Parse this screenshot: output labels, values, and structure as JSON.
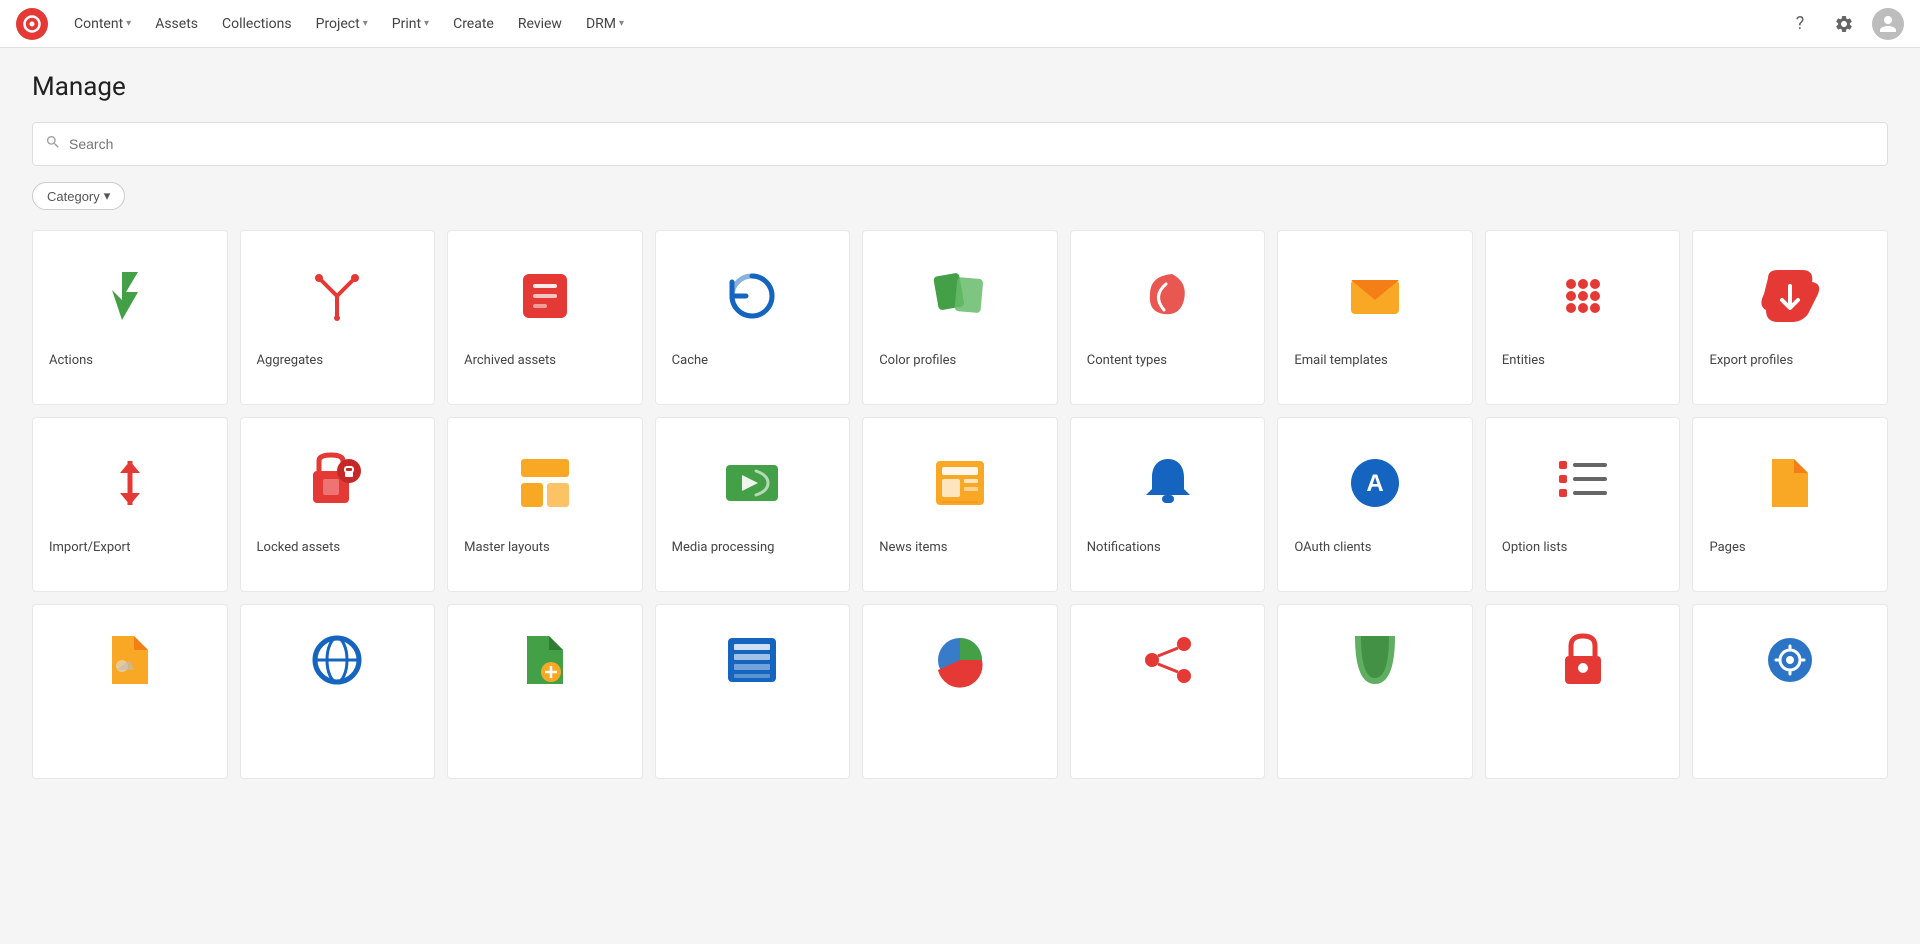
{
  "navbar": {
    "logo_alt": "App logo",
    "items": [
      {
        "label": "Content",
        "has_dropdown": true
      },
      {
        "label": "Assets",
        "has_dropdown": false
      },
      {
        "label": "Collections",
        "has_dropdown": false
      },
      {
        "label": "Project",
        "has_dropdown": true
      },
      {
        "label": "Print",
        "has_dropdown": true
      },
      {
        "label": "Create",
        "has_dropdown": false
      },
      {
        "label": "Review",
        "has_dropdown": false
      },
      {
        "label": "DRM",
        "has_dropdown": true
      }
    ]
  },
  "page": {
    "title": "Manage"
  },
  "search": {
    "placeholder": "Search"
  },
  "category_button": "Category",
  "cards_row1": [
    {
      "id": "actions",
      "label": "Actions",
      "icon": "lightning"
    },
    {
      "id": "aggregates",
      "label": "Aggregates",
      "icon": "aggregates"
    },
    {
      "id": "archived-assets",
      "label": "Archived assets",
      "icon": "box"
    },
    {
      "id": "cache",
      "label": "Cache",
      "icon": "refresh"
    },
    {
      "id": "color-profiles",
      "label": "Color profiles",
      "icon": "palette"
    },
    {
      "id": "content-types",
      "label": "Content types",
      "icon": "feather"
    },
    {
      "id": "email-templates",
      "label": "Email templates",
      "icon": "envelope"
    },
    {
      "id": "entities",
      "label": "Entities",
      "icon": "dots-grid"
    },
    {
      "id": "export-profiles",
      "label": "Export profiles",
      "icon": "cloud-download"
    }
  ],
  "cards_row2": [
    {
      "id": "import-export",
      "label": "Import/Export",
      "icon": "import-export"
    },
    {
      "id": "locked-assets",
      "label": "Locked assets",
      "icon": "locked-image"
    },
    {
      "id": "master-layouts",
      "label": "Master layouts",
      "icon": "layout"
    },
    {
      "id": "media-processing",
      "label": "Media processing",
      "icon": "media"
    },
    {
      "id": "news-items",
      "label": "News items",
      "icon": "news"
    },
    {
      "id": "notifications",
      "label": "Notifications",
      "icon": "bell"
    },
    {
      "id": "oauth-clients",
      "label": "OAuth clients",
      "icon": "oauth"
    },
    {
      "id": "option-lists",
      "label": "Option lists",
      "icon": "option-list"
    },
    {
      "id": "pages",
      "label": "Pages",
      "icon": "page"
    }
  ],
  "cards_row3": [
    {
      "id": "r3-1",
      "label": "",
      "icon": "doc-image"
    },
    {
      "id": "r3-2",
      "label": "",
      "icon": "globe"
    },
    {
      "id": "r3-3",
      "label": "",
      "icon": "doc-settings"
    },
    {
      "id": "r3-4",
      "label": "",
      "icon": "table"
    },
    {
      "id": "r3-5",
      "label": "",
      "icon": "chart"
    },
    {
      "id": "r3-6",
      "label": "",
      "icon": "share"
    },
    {
      "id": "r3-7",
      "label": "",
      "icon": "scroll"
    },
    {
      "id": "r3-8",
      "label": "",
      "icon": "lock-red"
    },
    {
      "id": "r3-9",
      "label": "",
      "icon": "gear-blue"
    }
  ]
}
